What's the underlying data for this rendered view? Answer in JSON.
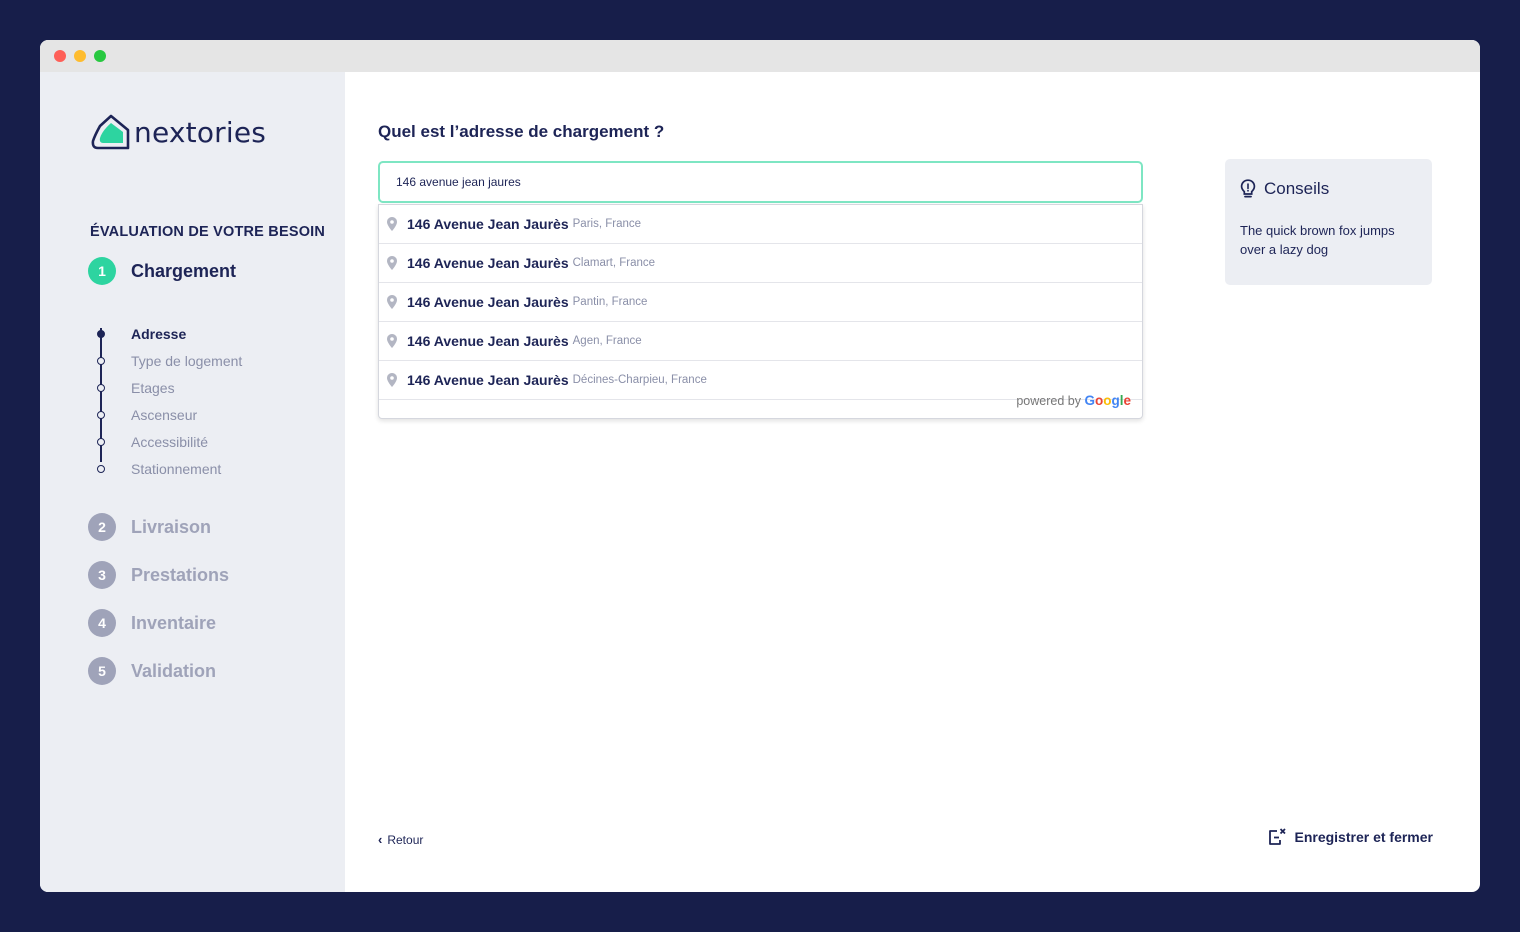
{
  "brand": {
    "name": "nextories"
  },
  "sidebar": {
    "section_title": "ÉVALUATION DE VOTRE BESOIN",
    "steps": [
      {
        "number": "1",
        "label": "Chargement",
        "state": "active"
      },
      {
        "number": "2",
        "label": "Livraison",
        "state": "inactive"
      },
      {
        "number": "3",
        "label": "Prestations",
        "state": "inactive"
      },
      {
        "number": "4",
        "label": "Inventaire",
        "state": "inactive"
      },
      {
        "number": "5",
        "label": "Validation",
        "state": "inactive"
      }
    ],
    "substeps": [
      {
        "label": "Adresse",
        "state": "current"
      },
      {
        "label": "Type de logement",
        "state": "upcoming"
      },
      {
        "label": "Etages",
        "state": "upcoming"
      },
      {
        "label": "Ascenseur",
        "state": "upcoming"
      },
      {
        "label": "Accessibilité",
        "state": "upcoming"
      },
      {
        "label": "Stationnement",
        "state": "upcoming"
      }
    ]
  },
  "main": {
    "question": "Quel est l’adresse de chargement ?",
    "address_input": {
      "value": "146 avenue jean jaures",
      "placeholder": ""
    },
    "suggestions": [
      {
        "main": "146 Avenue Jean Jaurès",
        "secondary": "Paris, France"
      },
      {
        "main": "146 Avenue Jean Jaurès",
        "secondary": "Clamart, France"
      },
      {
        "main": "146 Avenue Jean Jaurès",
        "secondary": "Pantin, France"
      },
      {
        "main": "146 Avenue Jean Jaurès",
        "secondary": "Agen, France"
      },
      {
        "main": "146 Avenue Jean Jaurès",
        "secondary": "Décines-Charpieu, France"
      }
    ],
    "powered_by": "powered by",
    "powered_by_brand": [
      "G",
      "o",
      "o",
      "g",
      "l",
      "e"
    ]
  },
  "tips": {
    "title": "Conseils",
    "body": "The quick brown fox jumps over a lazy dog"
  },
  "footer": {
    "back_label": "Retour",
    "save_close_label": "Enregistrer et fermer"
  },
  "colors": {
    "background": "#171e4a",
    "primary_text": "#1d2456",
    "accent_green": "#2dd4a0",
    "input_border": "#7ee6c3",
    "sidebar_bg": "#eceef3",
    "inactive_step": "#9fa3b9",
    "google_blue": "#4285f4",
    "google_red": "#ea4335",
    "google_yellow": "#fbbc05",
    "google_green": "#34a853"
  },
  "icons": {
    "logo": "house-leaf-logo-icon",
    "suggestion": "map-pin-icon",
    "tips": "lightbulb-icon",
    "back": "chevron-left-icon",
    "save_close": "exit-icon"
  }
}
